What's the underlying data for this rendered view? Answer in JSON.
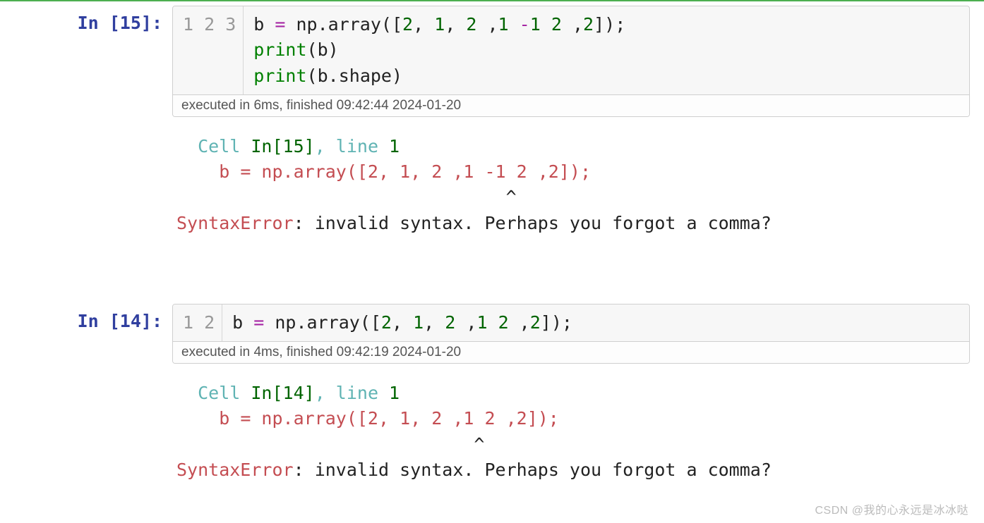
{
  "cells": [
    {
      "prompt_label": "In ",
      "prompt_num": "[15]:",
      "gutter": [
        "1",
        "2",
        "3"
      ],
      "code": {
        "l1": {
          "var": "b",
          "eq": " = ",
          "np": "np",
          "dot": ".",
          "arr": "array",
          "open": "([",
          "n1": "2",
          "c1": ", ",
          "n2": "1",
          "c2": ", ",
          "n3": "2",
          "c3": " ,",
          "n4": "1",
          "sp": " ",
          "minus": "-",
          "n5": "1",
          "sp2": " ",
          "n6": "2",
          "c4": " ,",
          "n7": "2",
          "close": "]);"
        },
        "l2": {
          "print": "print",
          "open": "(",
          "arg": "b",
          "close": ")"
        },
        "l3": {
          "print": "print",
          "open": "(",
          "arg": "b",
          "dot": ".",
          "attr": "shape",
          "close": ")"
        }
      },
      "exec": "executed in 6ms, finished 09:42:44 2024-01-20",
      "output": {
        "cell_word": "Cell ",
        "in_ref": "In[15]",
        "line_ref": ", line ",
        "line_num": "1",
        "err_indent": "    ",
        "err_code": "b = np.array([2, 1, 2 ,1 -1 2 ,2]);",
        "caret_line": "                               ^",
        "err_name": "SyntaxError",
        "colon": ": ",
        "msg": "invalid syntax. Perhaps you forgot a comma?"
      }
    },
    {
      "prompt_label": "In ",
      "prompt_num": "[14]:",
      "gutter": [
        "1",
        "2"
      ],
      "code": {
        "l1": {
          "var": "b",
          "eq": " = ",
          "np": "np",
          "dot": ".",
          "arr": "array",
          "open": "([",
          "n1": "2",
          "c1": ", ",
          "n2": "1",
          "c2": ", ",
          "n3": "2",
          "c3": " ,",
          "n4": "1",
          "sp": " ",
          "n5": "2",
          "c4": " ,",
          "n6": "2",
          "close": "]);"
        },
        "l2": {
          "empty": ""
        }
      },
      "exec": "executed in 4ms, finished 09:42:19 2024-01-20",
      "output": {
        "cell_word": "Cell ",
        "in_ref": "In[14]",
        "line_ref": ", line ",
        "line_num": "1",
        "err_indent": "    ",
        "err_code": "b = np.array([2, 1, 2 ,1 2 ,2]);",
        "caret_line": "                            ^",
        "err_name": "SyntaxError",
        "colon": ": ",
        "msg": "invalid syntax. Perhaps you forgot a comma?"
      }
    }
  ],
  "watermark": "CSDN @我的心永远是冰冰哒"
}
